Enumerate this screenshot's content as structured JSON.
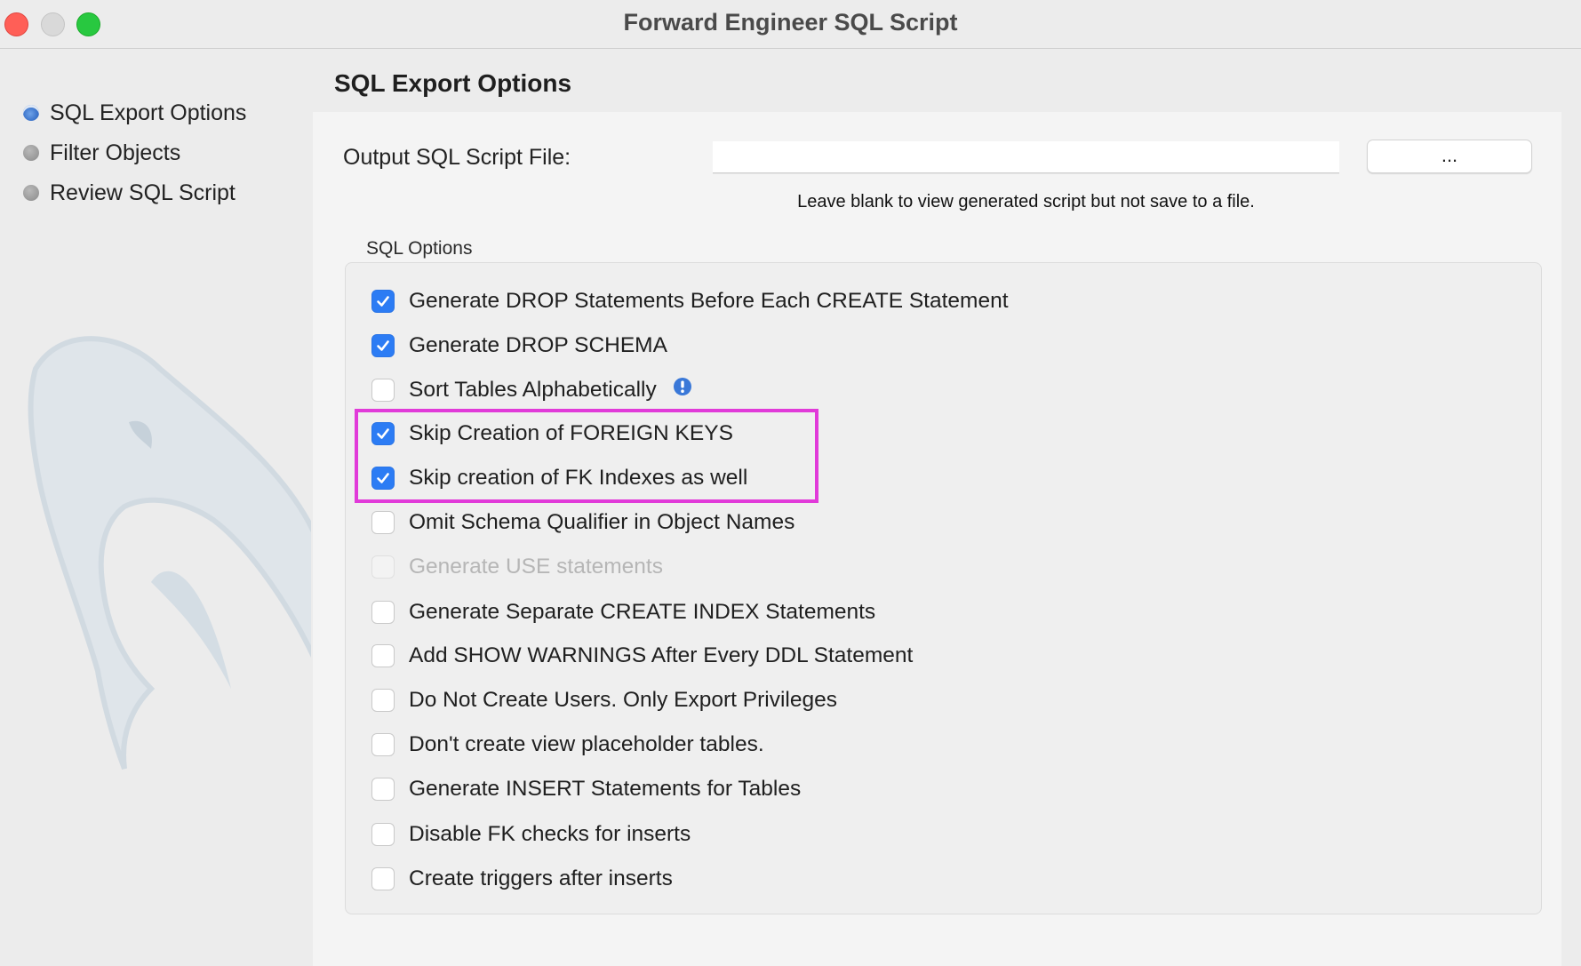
{
  "window": {
    "title": "Forward Engineer SQL Script"
  },
  "sidebar": {
    "items": [
      {
        "label": "SQL Export Options",
        "active": true
      },
      {
        "label": "Filter Objects",
        "active": false
      },
      {
        "label": "Review SQL Script",
        "active": false
      }
    ]
  },
  "main": {
    "heading": "SQL Export Options",
    "output_file": {
      "label": "Output SQL Script File:",
      "value": "",
      "browse_label": "...",
      "hint": "Leave blank to view generated script but not save to a file."
    },
    "sql_options": {
      "group_label": "SQL Options",
      "options": [
        {
          "label": "Generate DROP Statements Before Each CREATE Statement",
          "checked": true,
          "enabled": true
        },
        {
          "label": "Generate DROP SCHEMA",
          "checked": true,
          "enabled": true
        },
        {
          "label": "Sort Tables Alphabetically",
          "checked": false,
          "enabled": true,
          "has_info": true
        },
        {
          "label": "Skip Creation of FOREIGN KEYS",
          "checked": true,
          "enabled": true
        },
        {
          "label": "Skip creation of FK Indexes as well",
          "checked": true,
          "enabled": true
        },
        {
          "label": "Omit Schema Qualifier in Object Names",
          "checked": false,
          "enabled": true
        },
        {
          "label": "Generate USE statements",
          "checked": false,
          "enabled": false
        },
        {
          "label": "Generate Separate CREATE INDEX Statements",
          "checked": false,
          "enabled": true
        },
        {
          "label": "Add SHOW WARNINGS After Every DDL Statement",
          "checked": false,
          "enabled": true
        },
        {
          "label": "Do Not Create Users. Only Export Privileges",
          "checked": false,
          "enabled": true
        },
        {
          "label": "Don't create view placeholder tables.",
          "checked": false,
          "enabled": true
        },
        {
          "label": "Generate INSERT Statements for Tables",
          "checked": false,
          "enabled": true
        },
        {
          "label": "Disable FK checks for inserts",
          "checked": false,
          "enabled": true
        },
        {
          "label": "Create triggers after inserts",
          "checked": false,
          "enabled": true
        }
      ]
    }
  },
  "annotation": {
    "highlight_color": "#e13ad9"
  },
  "colors": {
    "checkbox_accent": "#2c7cf4",
    "info_icon": "#3a78d8"
  }
}
